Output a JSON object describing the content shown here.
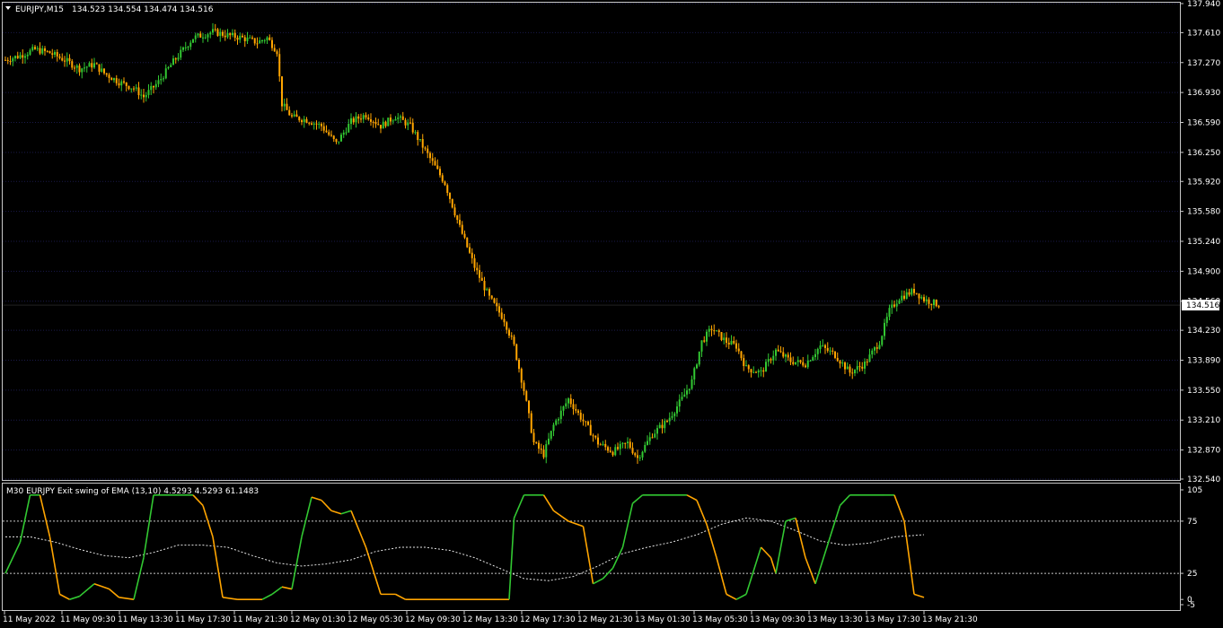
{
  "main_header": {
    "symbol": "EURJPY,M15",
    "ohlc": "134.523 134.554 134.474 134.516"
  },
  "price_axis": {
    "ticks": [
      "137.940",
      "137.610",
      "137.270",
      "136.930",
      "136.590",
      "136.250",
      "135.920",
      "135.580",
      "135.240",
      "134.900",
      "134.560",
      "134.230",
      "133.890",
      "133.550",
      "133.210",
      "132.870",
      "132.540"
    ],
    "current_price": "134.516"
  },
  "indicator": {
    "header": "M30 EURJPY Exit swing of EMA (13,10) 4.5293 4.5293 61.1483",
    "ticks": [
      "105",
      "75",
      "25",
      "0",
      "-5"
    ]
  },
  "time_axis": {
    "labels": [
      "11 May 2022",
      "11 May 09:30",
      "11 May 13:30",
      "11 May 17:30",
      "11 May 21:30",
      "12 May 01:30",
      "12 May 05:30",
      "12 May 09:30",
      "12 May 13:30",
      "12 May 17:30",
      "12 May 21:30",
      "13 May 01:30",
      "13 May 05:30",
      "13 May 09:30",
      "13 May 13:30",
      "13 May 17:30",
      "13 May 21:30"
    ]
  },
  "colors": {
    "background": "#000000",
    "grid": "#1a1a4a",
    "bull": "#32c832",
    "bear": "#ffa500",
    "text": "#ffffff",
    "frame": "#c8c8c8"
  },
  "chart_data": [
    {
      "type": "candlestick",
      "symbol": "EURJPY",
      "timeframe": "M15",
      "ylim": [
        132.54,
        137.94
      ],
      "close_path": [
        [
          0,
          137.3
        ],
        [
          6,
          137.35
        ],
        [
          12,
          137.42
        ],
        [
          18,
          137.38
        ],
        [
          24,
          137.3
        ],
        [
          30,
          137.2
        ],
        [
          36,
          137.25
        ],
        [
          40,
          137.15
        ],
        [
          46,
          137.05
        ],
        [
          52,
          136.98
        ],
        [
          56,
          136.88
        ],
        [
          62,
          137.05
        ],
        [
          68,
          137.28
        ],
        [
          76,
          137.55
        ],
        [
          84,
          137.62
        ],
        [
          90,
          137.58
        ],
        [
          96,
          137.55
        ],
        [
          102,
          137.5
        ],
        [
          106,
          137.55
        ],
        [
          110,
          137.4
        ],
        [
          112,
          136.8
        ],
        [
          116,
          136.65
        ],
        [
          122,
          136.62
        ],
        [
          128,
          136.55
        ],
        [
          134,
          136.35
        ],
        [
          140,
          136.6
        ],
        [
          146,
          136.68
        ],
        [
          152,
          136.55
        ],
        [
          158,
          136.66
        ],
        [
          164,
          136.55
        ],
        [
          172,
          136.18
        ],
        [
          178,
          135.9
        ],
        [
          184,
          135.4
        ],
        [
          190,
          134.95
        ],
        [
          196,
          134.6
        ],
        [
          202,
          134.35
        ],
        [
          206,
          134.05
        ],
        [
          210,
          133.55
        ],
        [
          214,
          132.95
        ],
        [
          218,
          132.82
        ],
        [
          222,
          133.15
        ],
        [
          228,
          133.45
        ],
        [
          234,
          133.2
        ],
        [
          240,
          132.95
        ],
        [
          246,
          132.85
        ],
        [
          252,
          132.95
        ],
        [
          256,
          132.78
        ],
        [
          262,
          133.05
        ],
        [
          268,
          133.2
        ],
        [
          274,
          133.45
        ],
        [
          278,
          133.65
        ],
        [
          282,
          134.1
        ],
        [
          286,
          134.25
        ],
        [
          292,
          134.1
        ],
        [
          296,
          134.05
        ],
        [
          300,
          133.8
        ],
        [
          306,
          133.75
        ],
        [
          312,
          134.0
        ],
        [
          318,
          133.88
        ],
        [
          324,
          133.85
        ],
        [
          330,
          134.05
        ],
        [
          336,
          133.95
        ],
        [
          342,
          133.75
        ],
        [
          348,
          133.85
        ],
        [
          354,
          134.1
        ],
        [
          358,
          134.45
        ],
        [
          362,
          134.6
        ],
        [
          368,
          134.68
        ],
        [
          372,
          134.58
        ],
        [
          378,
          134.52
        ]
      ]
    },
    {
      "type": "line",
      "title": "M30 EURJPY Exit swing of EMA (13,10)",
      "ylim": [
        -5,
        105
      ],
      "levels": [
        25,
        75
      ],
      "series": [
        {
          "role": "oscillator",
          "points": [
            [
              0,
              25
            ],
            [
              6,
              55
            ],
            [
              10,
              100
            ],
            [
              14,
              100
            ],
            [
              18,
              60
            ],
            [
              22,
              5
            ],
            [
              26,
              0
            ],
            [
              30,
              3
            ],
            [
              36,
              15
            ],
            [
              42,
              10
            ],
            [
              46,
              2
            ],
            [
              52,
              0
            ],
            [
              56,
              40
            ],
            [
              60,
              100
            ],
            [
              64,
              100
            ],
            [
              68,
              100
            ],
            [
              72,
              100
            ],
            [
              76,
              100
            ],
            [
              80,
              90
            ],
            [
              84,
              60
            ],
            [
              88,
              2
            ],
            [
              94,
              0
            ],
            [
              104,
              0
            ],
            [
              108,
              5
            ],
            [
              112,
              12
            ],
            [
              116,
              10
            ],
            [
              120,
              60
            ],
            [
              124,
              98
            ],
            [
              128,
              95
            ],
            [
              132,
              85
            ],
            [
              136,
              82
            ],
            [
              140,
              85
            ],
            [
              146,
              50
            ],
            [
              152,
              5
            ],
            [
              158,
              5
            ],
            [
              162,
              0
            ],
            [
              170,
              0
            ],
            [
              180,
              0
            ],
            [
              200,
              0
            ],
            [
              204,
              0
            ],
            [
              206,
              78
            ],
            [
              210,
              100
            ],
            [
              214,
              100
            ],
            [
              218,
              100
            ],
            [
              222,
              85
            ],
            [
              228,
              75
            ],
            [
              234,
              70
            ],
            [
              238,
              15
            ],
            [
              242,
              20
            ],
            [
              246,
              30
            ],
            [
              250,
              50
            ],
            [
              254,
              92
            ],
            [
              258,
              100
            ],
            [
              264,
              100
            ],
            [
              270,
              100
            ],
            [
              276,
              100
            ],
            [
              280,
              95
            ],
            [
              284,
              72
            ],
            [
              288,
              40
            ],
            [
              292,
              5
            ],
            [
              296,
              0
            ],
            [
              300,
              5
            ],
            [
              306,
              50
            ],
            [
              310,
              40
            ],
            [
              312,
              25
            ],
            [
              316,
              75
            ],
            [
              320,
              78
            ],
            [
              324,
              40
            ],
            [
              328,
              15
            ],
            [
              334,
              60
            ],
            [
              338,
              90
            ],
            [
              342,
              100
            ],
            [
              348,
              100
            ],
            [
              356,
              100
            ],
            [
              360,
              100
            ],
            [
              364,
              75
            ],
            [
              368,
              5
            ],
            [
              372,
              2
            ]
          ]
        },
        {
          "role": "signal",
          "points": [
            [
              0,
              60
            ],
            [
              10,
              60
            ],
            [
              20,
              55
            ],
            [
              30,
              48
            ],
            [
              40,
              42
            ],
            [
              50,
              40
            ],
            [
              60,
              45
            ],
            [
              70,
              52
            ],
            [
              80,
              52
            ],
            [
              90,
              50
            ],
            [
              100,
              42
            ],
            [
              110,
              35
            ],
            [
              120,
              32
            ],
            [
              130,
              34
            ],
            [
              140,
              38
            ],
            [
              150,
              46
            ],
            [
              160,
              50
            ],
            [
              170,
              50
            ],
            [
              180,
              47
            ],
            [
              190,
              40
            ],
            [
              200,
              30
            ],
            [
              210,
              20
            ],
            [
              220,
              18
            ],
            [
              230,
              22
            ],
            [
              240,
              32
            ],
            [
              250,
              44
            ],
            [
              260,
              50
            ],
            [
              270,
              55
            ],
            [
              280,
              62
            ],
            [
              290,
              72
            ],
            [
              300,
              78
            ],
            [
              310,
              75
            ],
            [
              320,
              66
            ],
            [
              330,
              56
            ],
            [
              340,
              52
            ],
            [
              350,
              54
            ],
            [
              360,
              60
            ],
            [
              372,
              62
            ]
          ]
        }
      ]
    }
  ]
}
